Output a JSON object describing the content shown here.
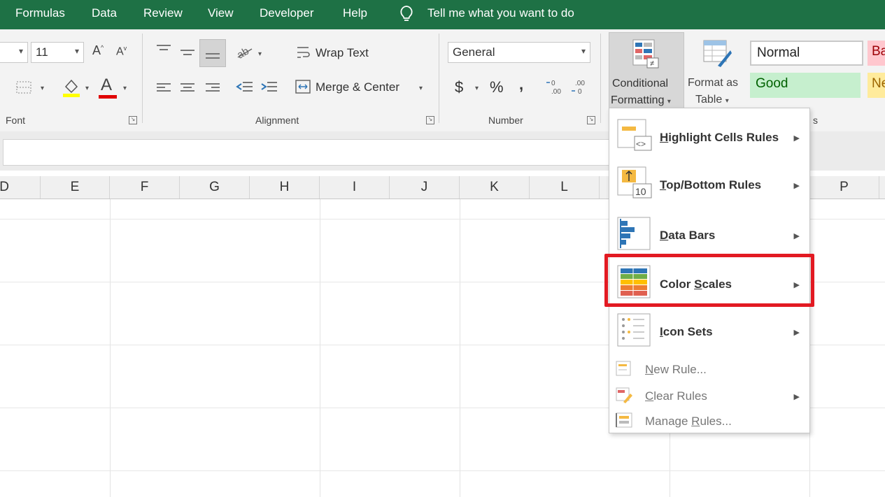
{
  "menubar": {
    "tabs": [
      "Formulas",
      "Data",
      "Review",
      "View",
      "Developer",
      "Help"
    ],
    "tell_me": "Tell me what you want to do"
  },
  "ribbon": {
    "font_size": "11",
    "font_group_label": "Font",
    "alignment_group_label": "Alignment",
    "number_group_label": "Number",
    "wrap_text": "Wrap Text",
    "merge_center": "Merge & Center",
    "number_format": "General",
    "currency": "$",
    "percent": "%",
    "comma": ",",
    "increase_font": "A",
    "decrease_font": "A",
    "font_color_letter": "A",
    "cf_label_line1": "Conditional",
    "cf_label_line2": "Formatting",
    "fat_label_line1": "Format as",
    "fat_label_line2": "Table",
    "styles": {
      "normal": "Normal",
      "bad": "Ba",
      "good": "Good",
      "neutral": "Ne"
    },
    "styles_group_tail": "s"
  },
  "columns": [
    "D",
    "E",
    "F",
    "G",
    "H",
    "I",
    "J",
    "K",
    "L",
    "P"
  ],
  "cf_menu": {
    "items": [
      {
        "label": "Highlight Cells Rules",
        "underline": "H",
        "rest": "ighlight Cells Rules"
      },
      {
        "label": "Top/Bottom Rules",
        "underline": "T",
        "rest": "op/Bottom Rules"
      },
      {
        "label": "Data Bars",
        "underline": "D",
        "rest": "ata Bars"
      },
      {
        "label": "Color Scales",
        "pre": "Color ",
        "underline": "S",
        "rest": "cales"
      },
      {
        "label": "Icon Sets",
        "pre": "",
        "underline": "I",
        "rest": "con Sets"
      }
    ],
    "secondary": [
      {
        "pre": "",
        "underline": "N",
        "rest": "ew Rule..."
      },
      {
        "pre": "",
        "underline": "C",
        "rest": "lear Rules"
      },
      {
        "pre": "Manage ",
        "underline": "R",
        "rest": "ules..."
      }
    ],
    "top_bottom_icon_text": "10",
    "highlight_icon_text": "<>"
  },
  "colors": {
    "menubar_bg": "#1e7145",
    "highlight_border": "#e21a22",
    "good_bg": "#c6efce",
    "good_text": "#006100",
    "bad_bg": "#ffc7ce",
    "neutral_bg": "#ffeb9c"
  }
}
